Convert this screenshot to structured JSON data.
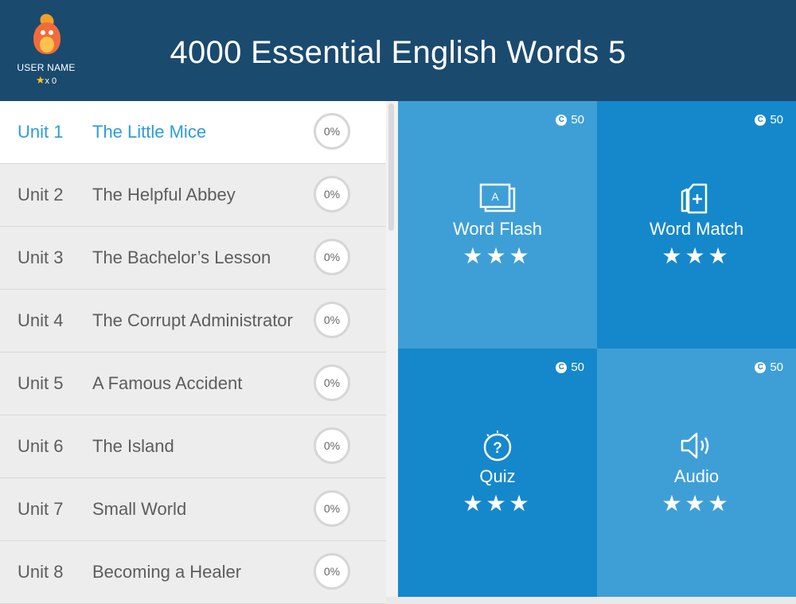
{
  "header": {
    "title": "4000 Essential English Words 5",
    "user_name": "USER NAME",
    "stars": "x 0"
  },
  "units": [
    {
      "unit": "Unit 1",
      "name": "The Little Mice",
      "progress": "0%",
      "active": true
    },
    {
      "unit": "Unit 2",
      "name": "The Helpful Abbey",
      "progress": "0%"
    },
    {
      "unit": "Unit 3",
      "name": "The Bachelor’s Lesson",
      "progress": "0%"
    },
    {
      "unit": "Unit 4",
      "name": "The Corrupt Administrator",
      "progress": "0%"
    },
    {
      "unit": "Unit 5",
      "name": "A Famous Accident",
      "progress": "0%"
    },
    {
      "unit": "Unit 6",
      "name": "The Island",
      "progress": "0%"
    },
    {
      "unit": "Unit 7",
      "name": "Small World",
      "progress": "0%"
    },
    {
      "unit": "Unit 8",
      "name": "Becoming a Healer",
      "progress": "0%"
    }
  ],
  "activities": [
    {
      "label": "Word Flash",
      "coins": "50",
      "stars": "★★★",
      "icon": "flashcard-icon"
    },
    {
      "label": "Word Match",
      "coins": "50",
      "stars": "★★★",
      "icon": "card-match-icon"
    },
    {
      "label": "Quiz",
      "coins": "50",
      "stars": "★★★",
      "icon": "quiz-bulb-icon"
    },
    {
      "label": "Audio",
      "coins": "50",
      "stars": "★★★",
      "icon": "speaker-icon"
    }
  ],
  "colors": {
    "header": "#1a4a6e",
    "accent": "#2e9cd9",
    "tile_light": "#3e9fd6",
    "tile_dark": "#1588cb"
  }
}
